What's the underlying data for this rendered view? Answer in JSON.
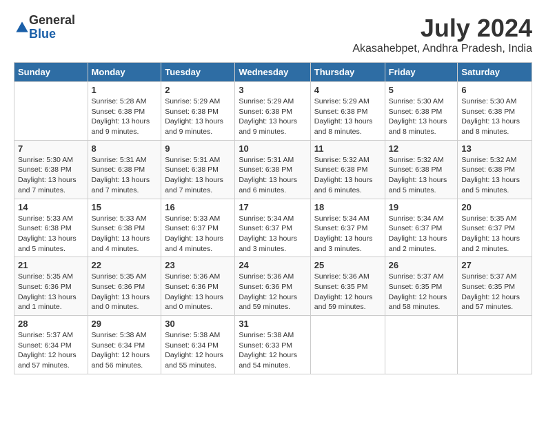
{
  "header": {
    "logo": {
      "general": "General",
      "blue": "Blue"
    },
    "title": "July 2024",
    "location": "Akasahebpet, Andhra Pradesh, India"
  },
  "calendar": {
    "days_of_week": [
      "Sunday",
      "Monday",
      "Tuesday",
      "Wednesday",
      "Thursday",
      "Friday",
      "Saturday"
    ],
    "weeks": [
      [
        {
          "day": "",
          "info": ""
        },
        {
          "day": "1",
          "info": "Sunrise: 5:28 AM\nSunset: 6:38 PM\nDaylight: 13 hours\nand 9 minutes."
        },
        {
          "day": "2",
          "info": "Sunrise: 5:29 AM\nSunset: 6:38 PM\nDaylight: 13 hours\nand 9 minutes."
        },
        {
          "day": "3",
          "info": "Sunrise: 5:29 AM\nSunset: 6:38 PM\nDaylight: 13 hours\nand 9 minutes."
        },
        {
          "day": "4",
          "info": "Sunrise: 5:29 AM\nSunset: 6:38 PM\nDaylight: 13 hours\nand 8 minutes."
        },
        {
          "day": "5",
          "info": "Sunrise: 5:30 AM\nSunset: 6:38 PM\nDaylight: 13 hours\nand 8 minutes."
        },
        {
          "day": "6",
          "info": "Sunrise: 5:30 AM\nSunset: 6:38 PM\nDaylight: 13 hours\nand 8 minutes."
        }
      ],
      [
        {
          "day": "7",
          "info": "Sunrise: 5:30 AM\nSunset: 6:38 PM\nDaylight: 13 hours\nand 7 minutes."
        },
        {
          "day": "8",
          "info": "Sunrise: 5:31 AM\nSunset: 6:38 PM\nDaylight: 13 hours\nand 7 minutes."
        },
        {
          "day": "9",
          "info": "Sunrise: 5:31 AM\nSunset: 6:38 PM\nDaylight: 13 hours\nand 7 minutes."
        },
        {
          "day": "10",
          "info": "Sunrise: 5:31 AM\nSunset: 6:38 PM\nDaylight: 13 hours\nand 6 minutes."
        },
        {
          "day": "11",
          "info": "Sunrise: 5:32 AM\nSunset: 6:38 PM\nDaylight: 13 hours\nand 6 minutes."
        },
        {
          "day": "12",
          "info": "Sunrise: 5:32 AM\nSunset: 6:38 PM\nDaylight: 13 hours\nand 5 minutes."
        },
        {
          "day": "13",
          "info": "Sunrise: 5:32 AM\nSunset: 6:38 PM\nDaylight: 13 hours\nand 5 minutes."
        }
      ],
      [
        {
          "day": "14",
          "info": "Sunrise: 5:33 AM\nSunset: 6:38 PM\nDaylight: 13 hours\nand 5 minutes."
        },
        {
          "day": "15",
          "info": "Sunrise: 5:33 AM\nSunset: 6:38 PM\nDaylight: 13 hours\nand 4 minutes."
        },
        {
          "day": "16",
          "info": "Sunrise: 5:33 AM\nSunset: 6:37 PM\nDaylight: 13 hours\nand 4 minutes."
        },
        {
          "day": "17",
          "info": "Sunrise: 5:34 AM\nSunset: 6:37 PM\nDaylight: 13 hours\nand 3 minutes."
        },
        {
          "day": "18",
          "info": "Sunrise: 5:34 AM\nSunset: 6:37 PM\nDaylight: 13 hours\nand 3 minutes."
        },
        {
          "day": "19",
          "info": "Sunrise: 5:34 AM\nSunset: 6:37 PM\nDaylight: 13 hours\nand 2 minutes."
        },
        {
          "day": "20",
          "info": "Sunrise: 5:35 AM\nSunset: 6:37 PM\nDaylight: 13 hours\nand 2 minutes."
        }
      ],
      [
        {
          "day": "21",
          "info": "Sunrise: 5:35 AM\nSunset: 6:36 PM\nDaylight: 13 hours\nand 1 minute."
        },
        {
          "day": "22",
          "info": "Sunrise: 5:35 AM\nSunset: 6:36 PM\nDaylight: 13 hours\nand 0 minutes."
        },
        {
          "day": "23",
          "info": "Sunrise: 5:36 AM\nSunset: 6:36 PM\nDaylight: 13 hours\nand 0 minutes."
        },
        {
          "day": "24",
          "info": "Sunrise: 5:36 AM\nSunset: 6:36 PM\nDaylight: 12 hours\nand 59 minutes."
        },
        {
          "day": "25",
          "info": "Sunrise: 5:36 AM\nSunset: 6:35 PM\nDaylight: 12 hours\nand 59 minutes."
        },
        {
          "day": "26",
          "info": "Sunrise: 5:37 AM\nSunset: 6:35 PM\nDaylight: 12 hours\nand 58 minutes."
        },
        {
          "day": "27",
          "info": "Sunrise: 5:37 AM\nSunset: 6:35 PM\nDaylight: 12 hours\nand 57 minutes."
        }
      ],
      [
        {
          "day": "28",
          "info": "Sunrise: 5:37 AM\nSunset: 6:34 PM\nDaylight: 12 hours\nand 57 minutes."
        },
        {
          "day": "29",
          "info": "Sunrise: 5:38 AM\nSunset: 6:34 PM\nDaylight: 12 hours\nand 56 minutes."
        },
        {
          "day": "30",
          "info": "Sunrise: 5:38 AM\nSunset: 6:34 PM\nDaylight: 12 hours\nand 55 minutes."
        },
        {
          "day": "31",
          "info": "Sunrise: 5:38 AM\nSunset: 6:33 PM\nDaylight: 12 hours\nand 54 minutes."
        },
        {
          "day": "",
          "info": ""
        },
        {
          "day": "",
          "info": ""
        },
        {
          "day": "",
          "info": ""
        }
      ]
    ]
  }
}
